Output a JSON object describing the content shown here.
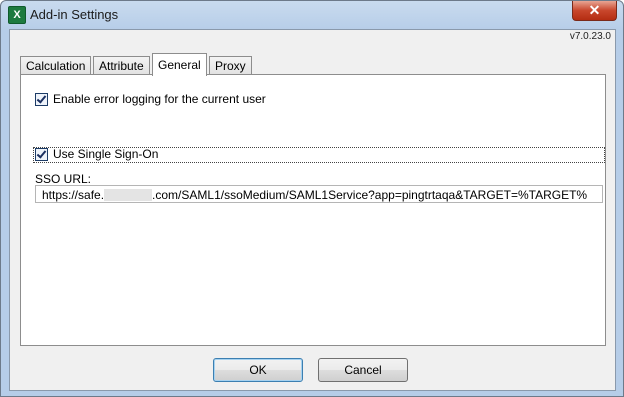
{
  "window": {
    "title": "Add-in Settings",
    "app_icon_glyph": "X",
    "close_glyph": "✕"
  },
  "version": "v7.0.23.0",
  "tabs": [
    {
      "label": "Calculation"
    },
    {
      "label": "Attribute"
    },
    {
      "label": "General",
      "active": true
    },
    {
      "label": "Proxy"
    }
  ],
  "general": {
    "error_logging": {
      "label": "Enable error logging for the current user",
      "checked": true
    },
    "sso": {
      "label": "Use Single Sign-On",
      "checked": true
    },
    "sso_url_label": "SSO URL:",
    "sso_url_prefix": "https://safe.",
    "sso_url_suffix": ".com/SAML1/ssoMedium/SAML1Service?app=pingtrtaqa&TARGET=%TARGET%"
  },
  "buttons": {
    "ok": "OK",
    "cancel": "Cancel"
  }
}
